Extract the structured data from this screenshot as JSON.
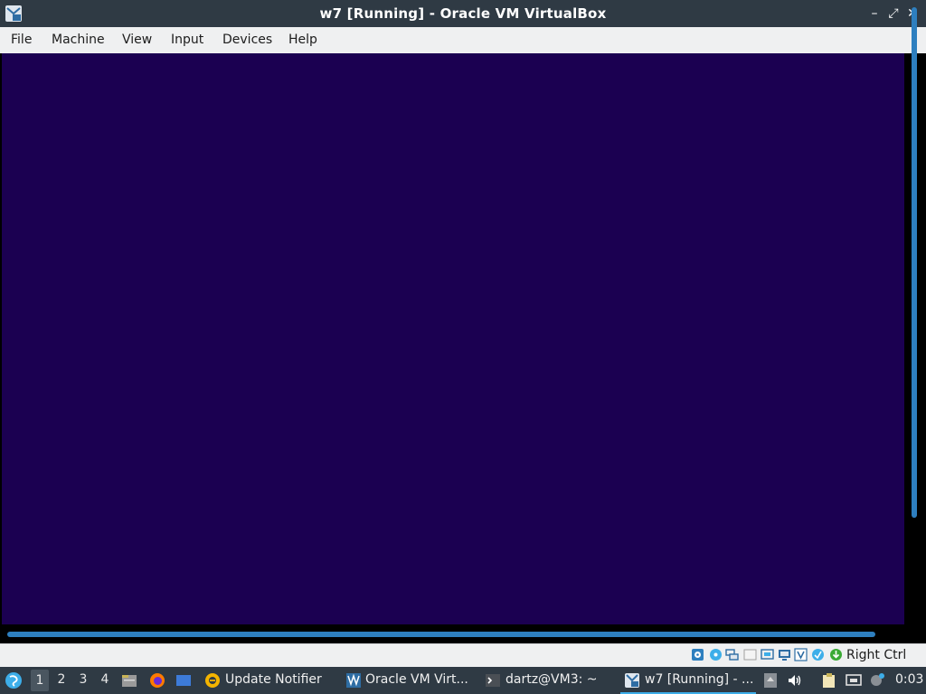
{
  "window": {
    "title": "w7 [Running] - Oracle VM VirtualBox",
    "minimize_glyph": "–",
    "restore_glyph": "⤢",
    "close_glyph": "✕"
  },
  "menubar": {
    "items": [
      "File",
      "Machine",
      "View",
      "Input",
      "Devices",
      "Help"
    ]
  },
  "vm_display": {
    "background_color": "#1b0051",
    "scrollbar_color": "#2e7fbf"
  },
  "statusbar": {
    "icons": [
      "hard-disk-icon",
      "optical-drive-icon",
      "network-icon",
      "usb-icon",
      "shared-folders-icon",
      "display-icon",
      "video-capture-icon",
      "virtualization-engine-icon",
      "mouse-integration-icon",
      "keyboard-capture-icon"
    ],
    "host_key": "Right Ctrl"
  },
  "taskbar": {
    "workspaces": [
      "1",
      "2",
      "3",
      "4"
    ],
    "active_workspace": "1",
    "launchers": [
      "app-menu-icon",
      "file-manager-icon",
      "firefox-icon",
      "show-desktop-icon"
    ],
    "tasks": [
      {
        "label": "Update Notifier",
        "icon": "update-notifier-icon"
      },
      {
        "label": "Oracle VM Virt...",
        "icon": "virtualbox-icon"
      },
      {
        "label": "dartz@VM3: ~",
        "icon": "terminal-icon"
      },
      {
        "label": "w7 [Running] - ...",
        "icon": "virtualbox-vm-icon",
        "active": true
      }
    ],
    "tray": [
      "tray-arrow-icon",
      "volume-icon",
      "clipboard-icon",
      "network-tray-icon",
      "notification-icon"
    ],
    "clock": "0:03"
  }
}
